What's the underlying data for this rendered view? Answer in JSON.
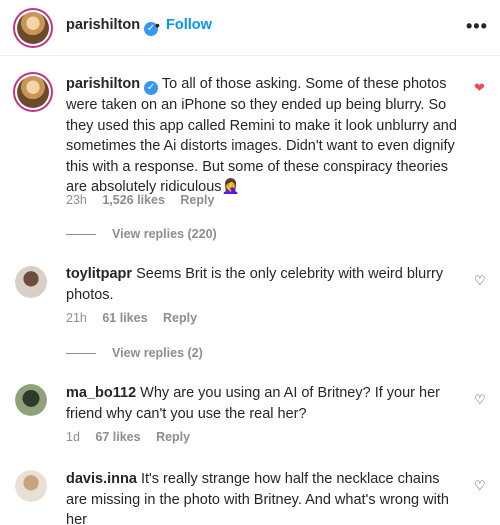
{
  "header": {
    "username": "parishilton",
    "separator": "•",
    "follow_label": "Follow",
    "more_label": "•••"
  },
  "comments": [
    {
      "username": "parishilton",
      "text": "To all of those asking. Some of these photos were taken on an iPhone so they ended up being blurry. So they used this app called Remini to make it look unblurry and sometimes the Ai distorts images. Didn't want to even dignify this with a response. But some of these conspiracy theories are absolutely ridiculous🤦‍♀️",
      "time": "23h",
      "likes": "1,526 likes",
      "reply_label": "Reply",
      "view_replies": "View replies (220)",
      "liked": true
    },
    {
      "username": "toylitpapr",
      "text": "Seems Brit is the only celebrity with weird blurry photos.",
      "time": "21h",
      "likes": "61 likes",
      "reply_label": "Reply",
      "view_replies": "View replies (2)",
      "liked": false
    },
    {
      "username": "ma_bo112",
      "text": "Why are you using an AI of Britney? If your her friend why can't you use the real her?",
      "time": "1d",
      "likes": "67 likes",
      "reply_label": "Reply",
      "liked": false
    },
    {
      "username": "davis.inna",
      "text": "It's really strange how half the necklace chains are missing in the photo with Britney. And what's wrong with her",
      "liked": false
    }
  ],
  "icons": {
    "verified": "verified-badge-icon",
    "liked_heart": "heart-filled-icon",
    "heart": "heart-outline-icon"
  },
  "colors": {
    "accent": "#0095f6",
    "liked": "#ed4956",
    "muted": "#8e8e8e",
    "verified": "#3897f0"
  }
}
